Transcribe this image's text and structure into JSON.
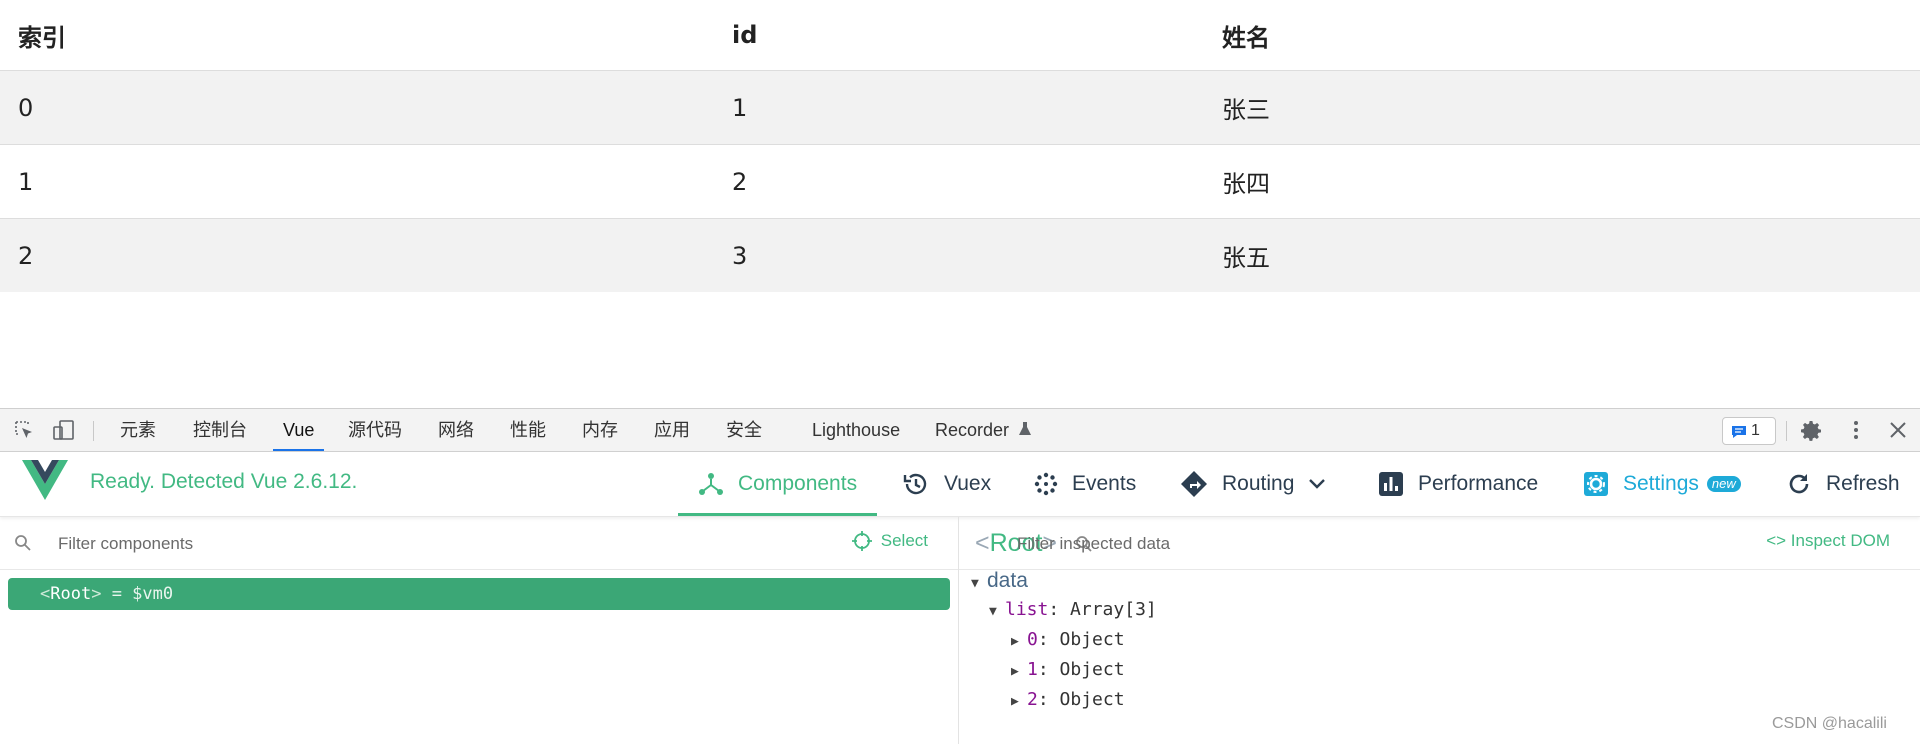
{
  "table": {
    "headers": [
      "索引",
      "id",
      "姓名"
    ],
    "rows": [
      [
        "0",
        "1",
        "张三"
      ],
      [
        "1",
        "2",
        "张四"
      ],
      [
        "2",
        "3",
        "张五"
      ]
    ]
  },
  "devtools": {
    "tabs": [
      "元素",
      "控制台",
      "Vue",
      "源代码",
      "网络",
      "性能",
      "内存",
      "应用",
      "安全",
      "Lighthouse",
      "Recorder"
    ],
    "active_tab": "Vue",
    "message_count": "1",
    "icons": [
      "inspect-element-icon",
      "device-toggle-icon",
      "recorder-flask-icon",
      "message-icon",
      "gear-icon",
      "more-vert-icon",
      "close-icon"
    ]
  },
  "vue": {
    "status": "Ready. Detected Vue 2.6.12.",
    "nav": {
      "components": "Components",
      "vuex": "Vuex",
      "events": "Events",
      "routing": "Routing",
      "performance": "Performance",
      "settings": "Settings",
      "settings_badge": "new",
      "refresh": "Refresh"
    },
    "components_pane": {
      "filter_placeholder": "Filter components",
      "select_label": "Select",
      "root_tag": "Root",
      "root_assign": "= $vm0"
    },
    "inspector": {
      "component": "Root",
      "filter_placeholder": "Filter inspected data",
      "inspect_dom": "Inspect DOM",
      "section": "data",
      "list_key": "list",
      "list_value": "Array[3]",
      "items": [
        {
          "key": "0",
          "value": "Object"
        },
        {
          "key": "1",
          "value": "Object"
        },
        {
          "key": "2",
          "value": "Object"
        }
      ]
    }
  },
  "watermark": "CSDN @hacalili",
  "colors": {
    "vue_green": "#42b983",
    "root_row": "#3ba776",
    "settings_blue": "#1eaad8",
    "devtools_active": "#1a73e8"
  }
}
